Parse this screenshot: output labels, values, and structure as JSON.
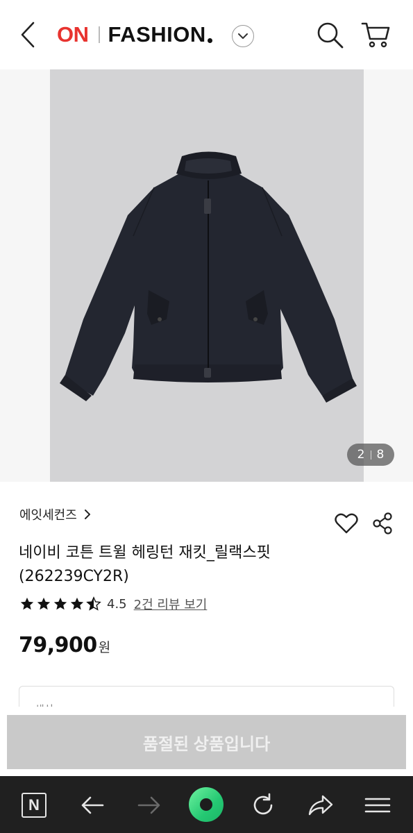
{
  "header": {
    "logo_on": "ON",
    "logo_fashion": "FASHION",
    "back_icon": "chevron-left-icon",
    "dropdown_icon": "chevron-down-icon",
    "search_icon": "search-icon",
    "cart_icon": "cart-icon",
    "brand_color": "#e8332f"
  },
  "gallery": {
    "current": "2",
    "total": "8"
  },
  "product": {
    "brand": "에잇세컨즈",
    "brand_chevron": ">",
    "title": "네이비 코튼 트윌 헤링턴 재킷_릴랙스핏 (262239CY2R)",
    "rating": 4.5,
    "rating_text": "4.5",
    "review_link": "2건 리뷰 보기",
    "price": "79,900",
    "currency": "원",
    "like_icon": "heart-icon",
    "share_icon": "share-icon"
  },
  "options": {
    "label": "색상"
  },
  "sold_out": {
    "label": "품절된 상품입니다"
  },
  "browser_toolbar": {
    "n_label": "N",
    "icons": [
      "n-home-icon",
      "back-arrow-icon",
      "forward-arrow-icon",
      "green-dot-icon",
      "refresh-icon",
      "share-arrow-icon",
      "menu-icon"
    ]
  }
}
